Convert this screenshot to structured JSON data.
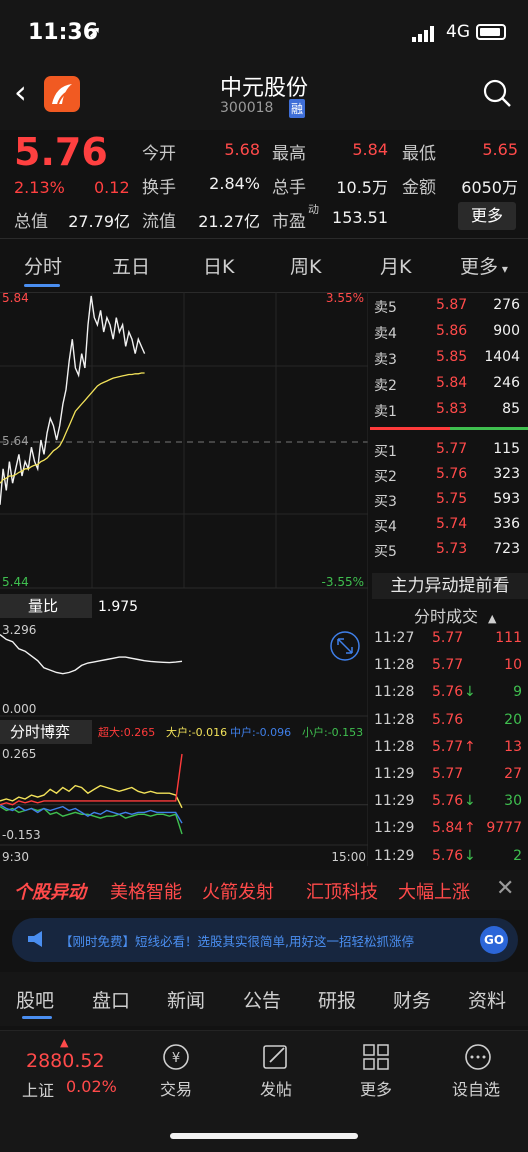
{
  "status_bar": {
    "time": "11:36",
    "network": "4G"
  },
  "header": {
    "title": "中元股份",
    "code": "300018",
    "margin_badge": "融",
    "back_icon": "back-arrow-icon",
    "search_icon": "search-icon"
  },
  "quote": {
    "price": "5.76",
    "change_pct": "2.13%",
    "change": "0.12",
    "rows": [
      [
        {
          "label": "今开",
          "value": "5.68",
          "color": "red"
        },
        {
          "label": "最高",
          "value": "5.84",
          "color": "red"
        },
        {
          "label": "最低",
          "value": "5.65",
          "color": "red"
        }
      ],
      [
        {
          "label": "换手",
          "value": "2.84%",
          "color": "white"
        },
        {
          "label": "总手",
          "value": "10.5万",
          "color": "white"
        },
        {
          "label": "金额",
          "value": "6050万",
          "color": "white"
        }
      ]
    ],
    "total_value_label": "总值",
    "total_value": "27.79亿",
    "float_value_label": "流值",
    "float_value": "21.27亿",
    "pe_label": "市盈",
    "pe_sup": "动",
    "pe": "153.51",
    "more_label": "更多"
  },
  "chart_tabs": [
    "分时",
    "五日",
    "日K",
    "周K",
    "月K",
    "更多"
  ],
  "chart_data": {
    "type": "line",
    "price_axis": {
      "top": "5.84",
      "mid": "5.64",
      "bottom": "5.44",
      "top_pct": "3.55%",
      "bottom_pct": "-3.55%"
    },
    "time_axis": {
      "start": "9:30",
      "end": "15:00"
    },
    "price_series": [
      5.55,
      5.6,
      5.57,
      5.61,
      5.58,
      5.6,
      5.62,
      5.59,
      5.61,
      5.6,
      5.63,
      5.61,
      5.6,
      5.64,
      5.62,
      5.65,
      5.67,
      5.66,
      5.64,
      5.66,
      5.69,
      5.71,
      5.75,
      5.78,
      5.74,
      5.73,
      5.76,
      5.74,
      5.8,
      5.84,
      5.81,
      5.8,
      5.82,
      5.79,
      5.81,
      5.8,
      5.78,
      5.81,
      5.79,
      5.8,
      5.77,
      5.79,
      5.78,
      5.76,
      5.78,
      5.77,
      5.76
    ],
    "avg_series": [
      5.58,
      5.585,
      5.587,
      5.59,
      5.59,
      5.592,
      5.595,
      5.597,
      5.6,
      5.6,
      5.603,
      5.605,
      5.606,
      5.61,
      5.612,
      5.615,
      5.62,
      5.625,
      5.628,
      5.632,
      5.64,
      5.65,
      5.66,
      5.67,
      5.68,
      5.685,
      5.69,
      5.695,
      5.7,
      5.705,
      5.71,
      5.715,
      5.718,
      5.72,
      5.722,
      5.724,
      5.726,
      5.727,
      5.728,
      5.729,
      5.73,
      5.731,
      5.731,
      5.732,
      5.732,
      5.733,
      5.733
    ],
    "volume_ratio": {
      "label": "量比",
      "value": "1.975",
      "ymax": "3.296",
      "ymin": "0.000",
      "series": [
        3.1,
        2.9,
        2.8,
        2.5,
        2.4,
        2.2,
        2.0,
        1.7,
        1.6,
        1.5,
        1.45,
        1.5,
        1.6,
        1.8,
        1.9,
        1.95,
        2.0,
        2.05,
        2.1,
        2.15,
        2.15,
        2.1,
        2.05,
        2.0,
        1.97,
        1.95,
        1.93,
        1.92,
        1.94,
        1.975
      ]
    },
    "game": {
      "label": "分时博弈",
      "ymax": "0.265",
      "ymin": "-0.153",
      "legend": [
        {
          "name": "超大:",
          "value": "0.265",
          "color": "#ff3b3b"
        },
        {
          "name": "大户:",
          "value": "-0.016",
          "color": "#f2e25a"
        },
        {
          "name": "中户:",
          "value": "-0.096",
          "color": "#3f7fe8"
        },
        {
          "name": "小户:",
          "value": "-0.153",
          "color": "#3fbf4f"
        }
      ],
      "super": [
        0.0,
        0.01,
        0.0,
        0.02,
        0.01,
        0.02,
        0.01,
        0.02,
        0.02,
        0.02,
        0.02,
        0.02,
        0.02,
        0.02,
        0.02,
        0.02,
        0.02,
        0.02,
        0.02,
        0.02,
        0.02,
        0.02,
        0.02,
        0.02,
        0.02,
        0.02,
        0.02,
        0.02,
        0.02,
        0.265
      ],
      "large": [
        0.02,
        0.03,
        0.02,
        0.04,
        0.03,
        0.05,
        0.04,
        0.05,
        0.08,
        0.06,
        0.09,
        0.07,
        0.1,
        0.09,
        0.06,
        0.08,
        0.1,
        0.09,
        0.08,
        0.07,
        0.08,
        0.09,
        0.07,
        0.06,
        0.07,
        0.06,
        0.06,
        0.06,
        0.05,
        -0.016
      ],
      "mid": [
        0.0,
        -0.02,
        -0.03,
        -0.01,
        -0.03,
        -0.02,
        -0.04,
        -0.02,
        -0.03,
        -0.02,
        -0.01,
        -0.03,
        -0.02,
        -0.04,
        -0.06,
        -0.04,
        -0.05,
        -0.03,
        -0.04,
        -0.05,
        -0.04,
        -0.05,
        -0.04,
        -0.04,
        -0.03,
        -0.04,
        -0.04,
        -0.04,
        -0.04,
        -0.096
      ],
      "small": [
        -0.01,
        -0.03,
        -0.02,
        -0.04,
        -0.03,
        -0.02,
        -0.03,
        -0.02,
        -0.05,
        -0.04,
        -0.06,
        -0.05,
        -0.04,
        -0.05,
        -0.05,
        -0.06,
        -0.07,
        -0.06,
        -0.06,
        -0.05,
        -0.07,
        -0.06,
        -0.05,
        -0.05,
        -0.06,
        -0.05,
        -0.05,
        -0.06,
        -0.05,
        -0.153
      ]
    }
  },
  "order_book": {
    "asks": [
      {
        "label": "卖5",
        "price": "5.87",
        "vol": "276"
      },
      {
        "label": "卖4",
        "price": "5.86",
        "vol": "900"
      },
      {
        "label": "卖3",
        "price": "5.85",
        "vol": "1404"
      },
      {
        "label": "卖2",
        "price": "5.84",
        "vol": "246"
      },
      {
        "label": "卖1",
        "price": "5.83",
        "vol": "85"
      }
    ],
    "bids": [
      {
        "label": "买1",
        "price": "5.77",
        "vol": "115"
      },
      {
        "label": "买2",
        "price": "5.76",
        "vol": "323"
      },
      {
        "label": "买3",
        "price": "5.75",
        "vol": "593"
      },
      {
        "label": "买4",
        "price": "5.74",
        "vol": "336"
      },
      {
        "label": "买5",
        "price": "5.73",
        "vol": "723"
      }
    ]
  },
  "main_force": {
    "title": "主力异动提前看"
  },
  "ticks_title": "分时成交",
  "ticks": [
    {
      "time": "11:27",
      "price": "5.77",
      "arrow": "",
      "vol": "111",
      "vol_color": "red"
    },
    {
      "time": "11:28",
      "price": "5.77",
      "arrow": "",
      "vol": "10",
      "vol_color": "red"
    },
    {
      "time": "11:28",
      "price": "5.76",
      "arrow": "↓",
      "vol": "9",
      "vol_color": "green"
    },
    {
      "time": "11:28",
      "price": "5.76",
      "arrow": "",
      "vol": "20",
      "vol_color": "green"
    },
    {
      "time": "11:28",
      "price": "5.77",
      "arrow": "↑",
      "vol": "13",
      "vol_color": "red"
    },
    {
      "time": "11:29",
      "price": "5.77",
      "arrow": "",
      "vol": "27",
      "vol_color": "red"
    },
    {
      "time": "11:29",
      "price": "5.76",
      "arrow": "↓",
      "vol": "30",
      "vol_color": "green"
    },
    {
      "time": "11:29",
      "price": "5.84",
      "arrow": "↑",
      "vol": "9777",
      "vol_color": "red"
    },
    {
      "time": "11:29",
      "price": "5.76",
      "arrow": "↓",
      "vol": "2",
      "vol_color": "green"
    }
  ],
  "alerts": {
    "head": "个股异动",
    "items": [
      "美格智能",
      "火箭发射",
      "汇顶科技",
      "大幅上涨"
    ],
    "close": "✕"
  },
  "banner": {
    "text": "【刚时免费】短线必看！选股其实很简单,用好这一招轻松抓涨停",
    "go": "GO"
  },
  "section_tabs": [
    "股吧",
    "盘口",
    "新闻",
    "公告",
    "研报",
    "财务",
    "资料"
  ],
  "tabbar": {
    "index_value": "2880.52",
    "index_name": "上证",
    "index_pct": "0.02%",
    "items": [
      {
        "label": "交易",
        "icon": "yen-trade-icon"
      },
      {
        "label": "发帖",
        "icon": "edit-post-icon"
      },
      {
        "label": "更多",
        "icon": "grid-more-icon"
      },
      {
        "label": "设自选",
        "icon": "add-watchlist-icon"
      }
    ]
  }
}
